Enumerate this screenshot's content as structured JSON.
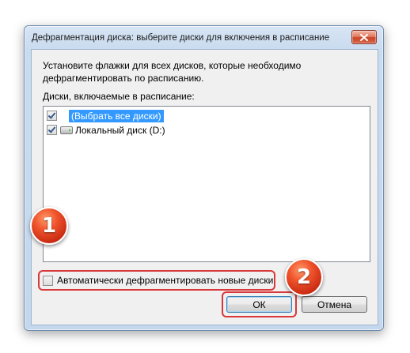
{
  "window": {
    "title": "Дефрагментация диска: выберите диски для включения в расписание",
    "close_label": "close"
  },
  "dialog": {
    "instruction": "Установите флажки для всех дисков, которые необходимо дефрагментировать по расписанию.",
    "list_label": "Диски, включаемые в расписание:",
    "items": [
      {
        "label": "(Выбрать все диски)",
        "checked": true,
        "selected": true
      },
      {
        "label": "Локальный диск (D:)",
        "checked": true,
        "selected": false,
        "icon": "drive-icon"
      }
    ],
    "auto_defrag_label": "Автоматически дефрагментировать новые диски",
    "auto_defrag_checked": false,
    "ok_label": "ОК",
    "cancel_label": "Отмена"
  },
  "annotations": {
    "badge_1": "1",
    "badge_2": "2",
    "highlight_color": "#d8383a",
    "badge_color": "#e0431f"
  }
}
